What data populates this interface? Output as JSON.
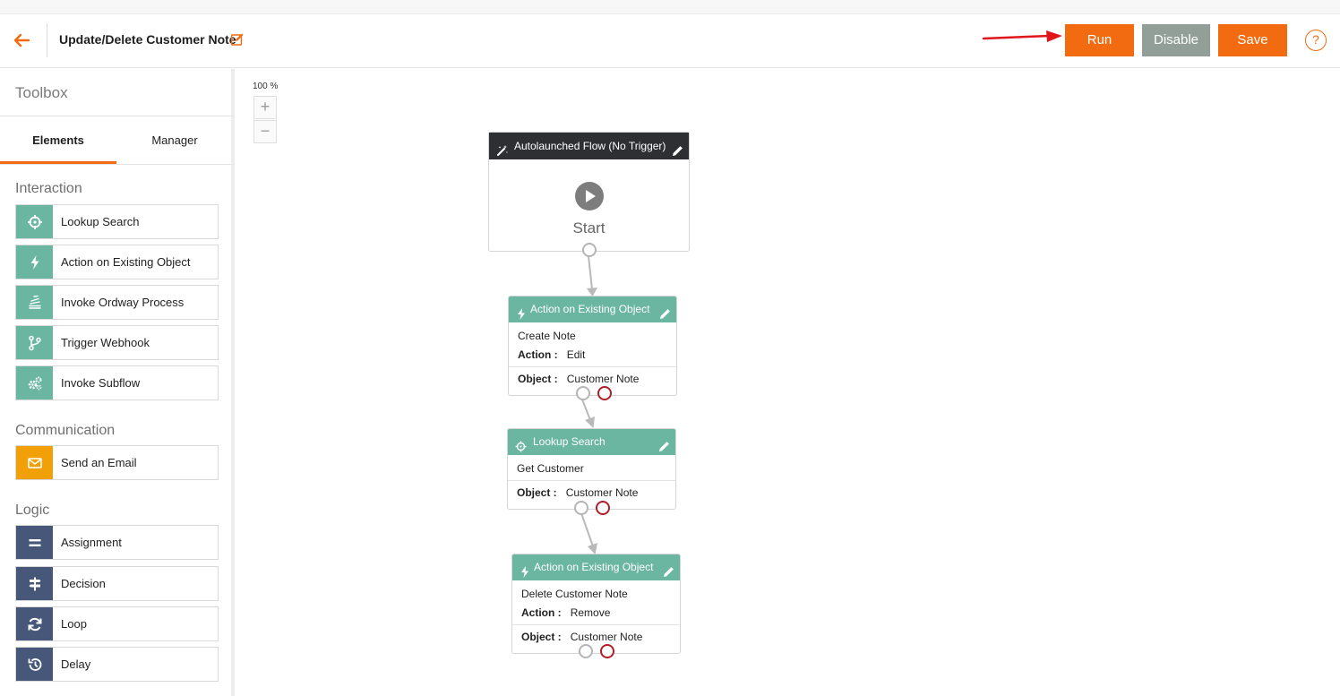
{
  "header": {
    "title": "Update/Delete Customer Note",
    "run_label": "Run",
    "disable_label": "Disable",
    "save_label": "Save",
    "help_label": "?"
  },
  "colors": {
    "accent": "#f26b10",
    "disabled_button": "#919f98",
    "element_green": "#6bb6a0",
    "communication_orange": "#f2a007",
    "logic_navy": "#46577a",
    "start_header": "#2d2f33",
    "error_port": "#b01e28"
  },
  "sidebar": {
    "title": "Toolbox",
    "tabs": [
      {
        "label": "Elements",
        "active": true
      },
      {
        "label": "Manager",
        "active": false
      }
    ],
    "sections": [
      {
        "title": "Interaction",
        "items": [
          {
            "label": "Lookup Search",
            "icon": "crosshair-icon"
          },
          {
            "label": "Action on Existing Object",
            "icon": "lightning-icon"
          },
          {
            "label": "Invoke Ordway Process",
            "icon": "stack-icon"
          },
          {
            "label": "Trigger Webhook",
            "icon": "branch-icon"
          },
          {
            "label": "Invoke Subflow",
            "icon": "gears-icon"
          }
        ]
      },
      {
        "title": "Communication",
        "items": [
          {
            "label": "Send an Email",
            "icon": "envelope-icon"
          }
        ]
      },
      {
        "title": "Logic",
        "items": [
          {
            "label": "Assignment",
            "icon": "equals-icon"
          },
          {
            "label": "Decision",
            "icon": "signpost-icon"
          },
          {
            "label": "Loop",
            "icon": "loop-icon"
          },
          {
            "label": "Delay",
            "icon": "history-icon"
          }
        ]
      }
    ]
  },
  "canvas": {
    "zoom_label": "100 %",
    "zoom_in": "+",
    "zoom_out": "−",
    "start_node": {
      "header": "Autolaunched Flow (No Trigger)",
      "label": "Start"
    },
    "nodes": [
      {
        "header": "Action on Existing Object",
        "name": "Create Note",
        "action_key": "Action :",
        "action_value": "Edit",
        "object_key": "Object :",
        "object_value": "Customer Note"
      },
      {
        "header": "Lookup Search",
        "name": "Get Customer",
        "object_key": "Object :",
        "object_value": "Customer Note"
      },
      {
        "header": "Action on Existing Object",
        "name": "Delete Customer Note",
        "action_key": "Action :",
        "action_value": "Remove",
        "object_key": "Object :",
        "object_value": "Customer Note"
      }
    ]
  }
}
